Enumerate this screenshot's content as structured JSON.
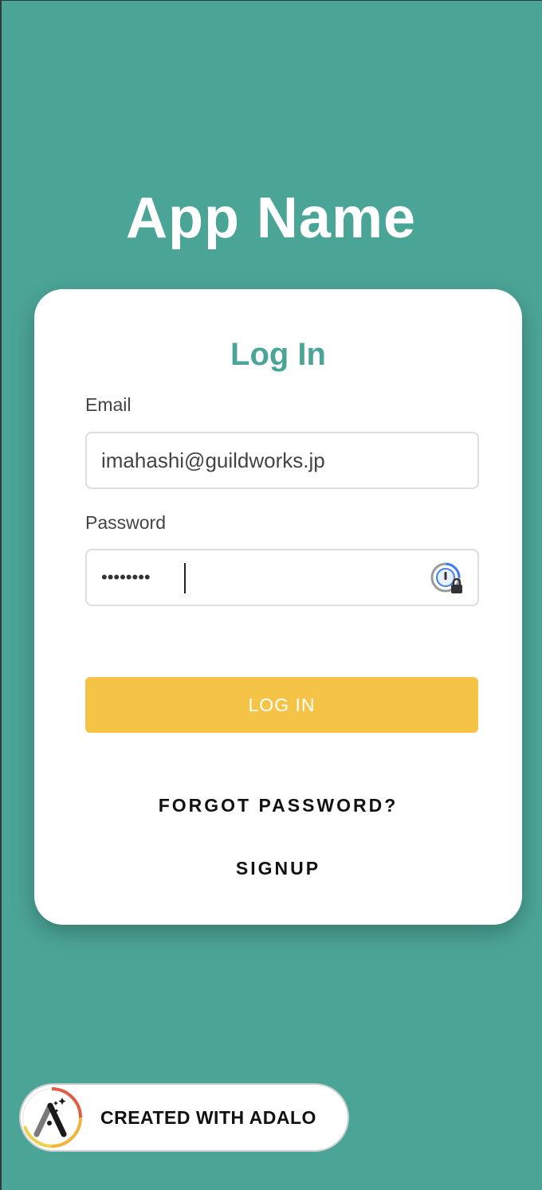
{
  "app": {
    "title": "App Name"
  },
  "login_card": {
    "title": "Log In",
    "email_label": "Email",
    "email_value": "imahashi@guildworks.jp",
    "password_label": "Password",
    "password_value_masked": "••••••••",
    "password_manager_icon": "password-manager-icon",
    "login_button_label": "LOG IN",
    "forgot_password_label": "FORGOT PASSWORD?",
    "signup_label": "SIGNUP"
  },
  "badge": {
    "label": "CREATED WITH ADALO",
    "logo_icon": "adalo-logo-icon"
  },
  "colors": {
    "background": "#4ba596",
    "accent": "#4ba596",
    "button": "#f5c446",
    "card": "#ffffff"
  }
}
